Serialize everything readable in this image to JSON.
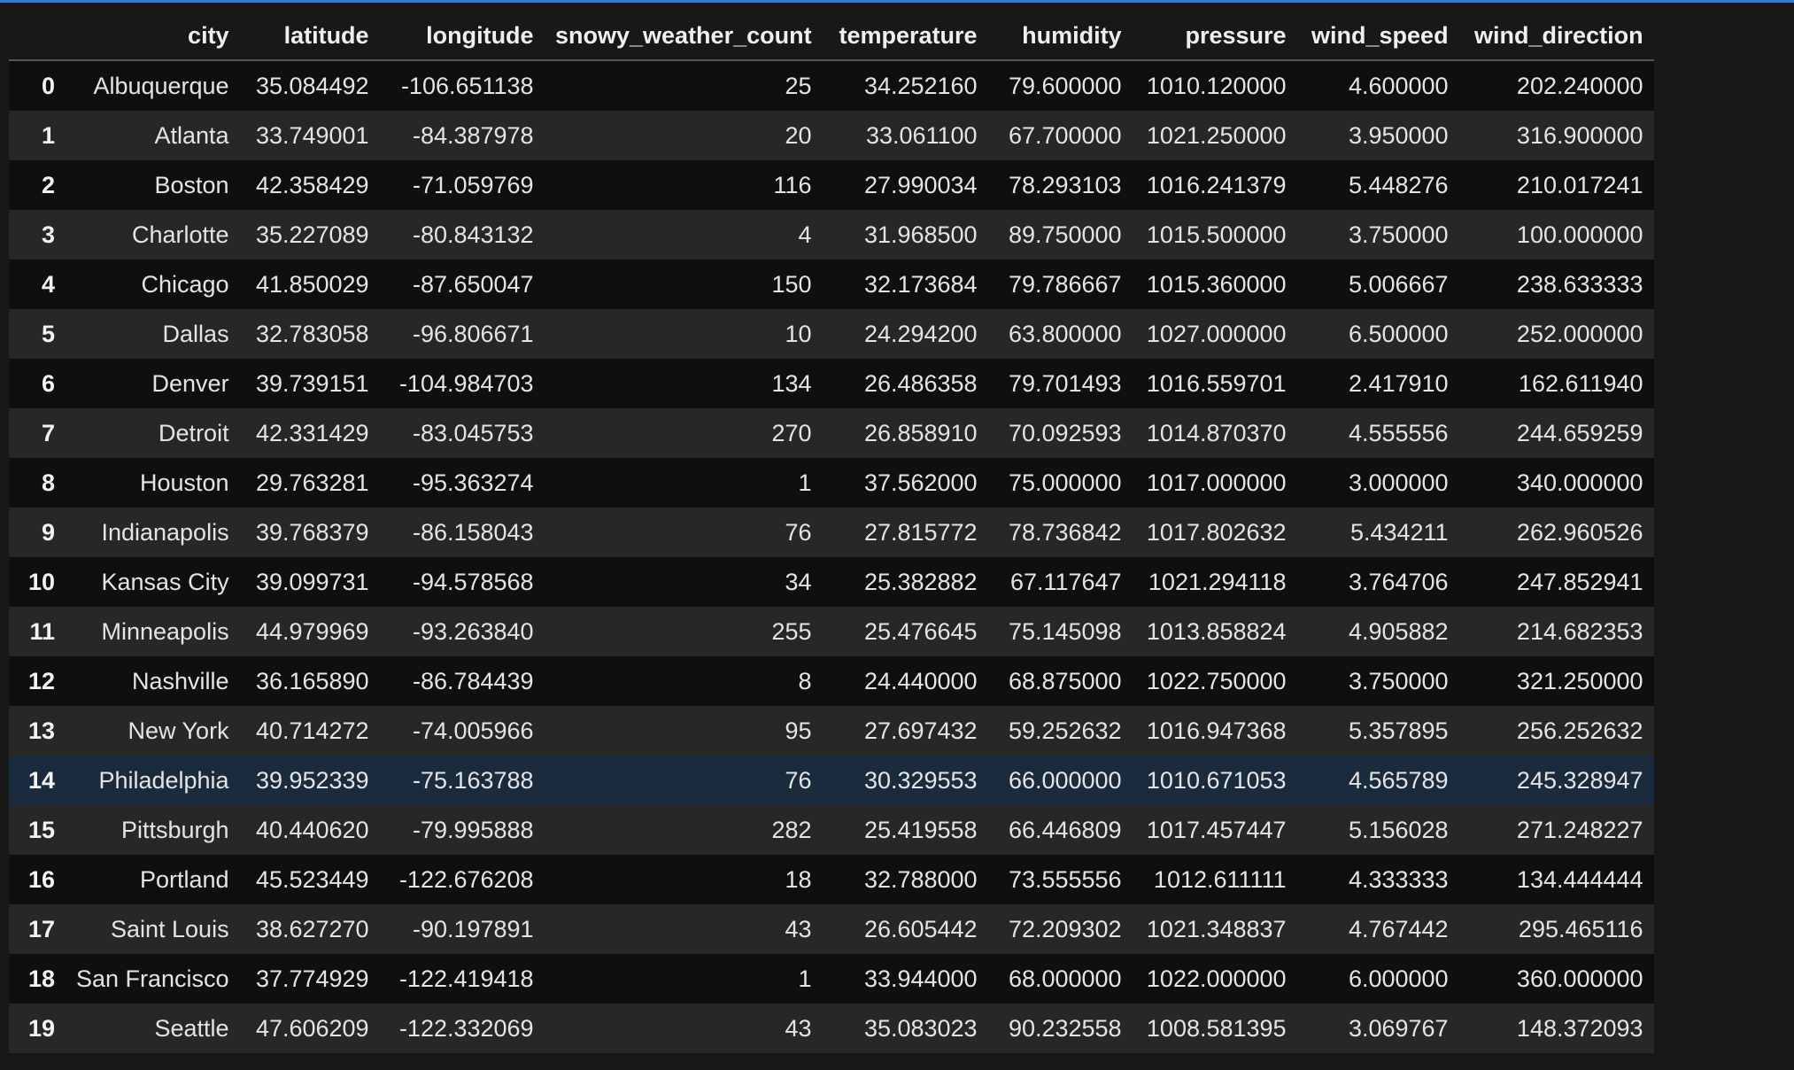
{
  "table": {
    "columns": [
      "",
      "city",
      "latitude",
      "longitude",
      "snowy_weather_count",
      "temperature",
      "humidity",
      "pressure",
      "wind_speed",
      "wind_direction"
    ],
    "rows": [
      [
        "0",
        "Albuquerque",
        "35.084492",
        "-106.651138",
        "25",
        "34.252160",
        "79.600000",
        "1010.120000",
        "4.600000",
        "202.240000"
      ],
      [
        "1",
        "Atlanta",
        "33.749001",
        "-84.387978",
        "20",
        "33.061100",
        "67.700000",
        "1021.250000",
        "3.950000",
        "316.900000"
      ],
      [
        "2",
        "Boston",
        "42.358429",
        "-71.059769",
        "116",
        "27.990034",
        "78.293103",
        "1016.241379",
        "5.448276",
        "210.017241"
      ],
      [
        "3",
        "Charlotte",
        "35.227089",
        "-80.843132",
        "4",
        "31.968500",
        "89.750000",
        "1015.500000",
        "3.750000",
        "100.000000"
      ],
      [
        "4",
        "Chicago",
        "41.850029",
        "-87.650047",
        "150",
        "32.173684",
        "79.786667",
        "1015.360000",
        "5.006667",
        "238.633333"
      ],
      [
        "5",
        "Dallas",
        "32.783058",
        "-96.806671",
        "10",
        "24.294200",
        "63.800000",
        "1027.000000",
        "6.500000",
        "252.000000"
      ],
      [
        "6",
        "Denver",
        "39.739151",
        "-104.984703",
        "134",
        "26.486358",
        "79.701493",
        "1016.559701",
        "2.417910",
        "162.611940"
      ],
      [
        "7",
        "Detroit",
        "42.331429",
        "-83.045753",
        "270",
        "26.858910",
        "70.092593",
        "1014.870370",
        "4.555556",
        "244.659259"
      ],
      [
        "8",
        "Houston",
        "29.763281",
        "-95.363274",
        "1",
        "37.562000",
        "75.000000",
        "1017.000000",
        "3.000000",
        "340.000000"
      ],
      [
        "9",
        "Indianapolis",
        "39.768379",
        "-86.158043",
        "76",
        "27.815772",
        "78.736842",
        "1017.802632",
        "5.434211",
        "262.960526"
      ],
      [
        "10",
        "Kansas City",
        "39.099731",
        "-94.578568",
        "34",
        "25.382882",
        "67.117647",
        "1021.294118",
        "3.764706",
        "247.852941"
      ],
      [
        "11",
        "Minneapolis",
        "44.979969",
        "-93.263840",
        "255",
        "25.476645",
        "75.145098",
        "1013.858824",
        "4.905882",
        "214.682353"
      ],
      [
        "12",
        "Nashville",
        "36.165890",
        "-86.784439",
        "8",
        "24.440000",
        "68.875000",
        "1022.750000",
        "3.750000",
        "321.250000"
      ],
      [
        "13",
        "New York",
        "40.714272",
        "-74.005966",
        "95",
        "27.697432",
        "59.252632",
        "1016.947368",
        "5.357895",
        "256.252632"
      ],
      [
        "14",
        "Philadelphia",
        "39.952339",
        "-75.163788",
        "76",
        "30.329553",
        "66.000000",
        "1010.671053",
        "4.565789",
        "245.328947"
      ],
      [
        "15",
        "Pittsburgh",
        "40.440620",
        "-79.995888",
        "282",
        "25.419558",
        "66.446809",
        "1017.457447",
        "5.156028",
        "271.248227"
      ],
      [
        "16",
        "Portland",
        "45.523449",
        "-122.676208",
        "18",
        "32.788000",
        "73.555556",
        "1012.611111",
        "4.333333",
        "134.444444"
      ],
      [
        "17",
        "Saint Louis",
        "38.627270",
        "-90.197891",
        "43",
        "26.605442",
        "72.209302",
        "1021.348837",
        "4.767442",
        "295.465116"
      ],
      [
        "18",
        "San Francisco",
        "37.774929",
        "-122.419418",
        "1",
        "33.944000",
        "68.000000",
        "1022.000000",
        "6.000000",
        "360.000000"
      ],
      [
        "19",
        "Seattle",
        "47.606209",
        "-122.332069",
        "43",
        "35.083023",
        "90.232558",
        "1008.581395",
        "3.069767",
        "148.372093"
      ]
    ],
    "hovered_row": "14"
  },
  "colors": {
    "background": "#181818",
    "row_dark": "#0f0f0f",
    "row_light": "#272727",
    "row_hover": "#1b2b3e",
    "accent": "#2f7bd8"
  }
}
